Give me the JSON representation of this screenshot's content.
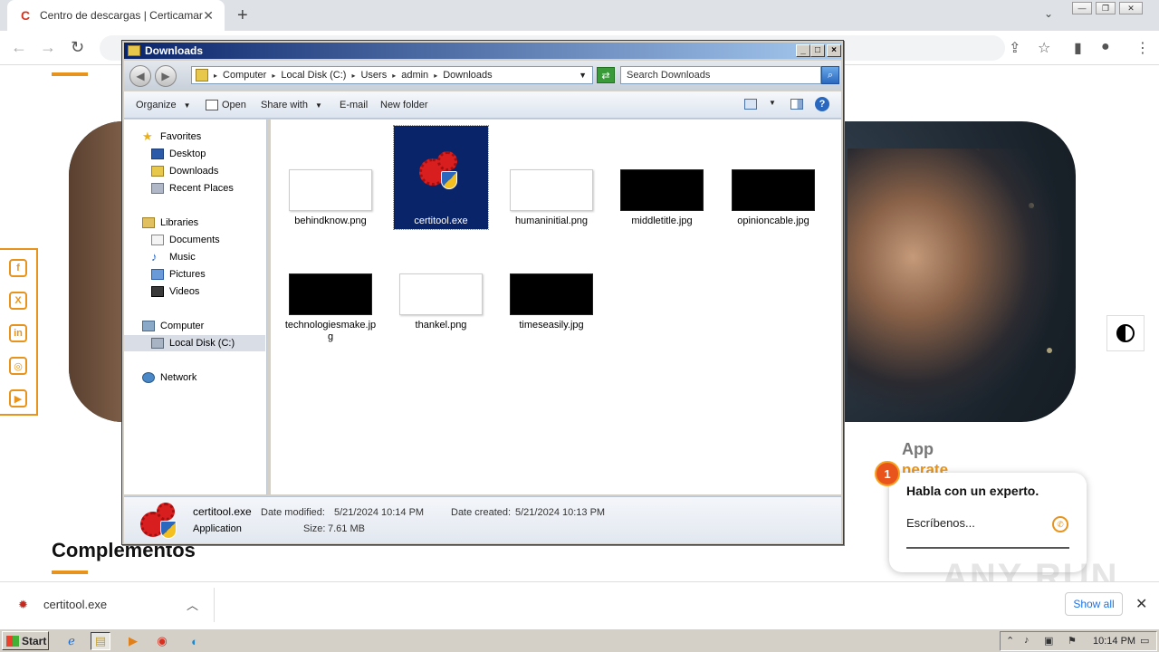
{
  "browser": {
    "tab_title": "Centro de descargas | Certicamara",
    "tab_favicon": "C",
    "new_tab": "+",
    "close_tab": "✕",
    "tab_search": "⌄",
    "win_min": "—",
    "win_restore": "❐",
    "win_close": "✕"
  },
  "page": {
    "app_heading": "App",
    "app_sub": "nerate",
    "complementos": "Complementos",
    "chat_badge": "1",
    "chat_title": "Habla con un experto.",
    "chat_placeholder": "Escríbenos...",
    "watermark": "ANY RUN",
    "social": [
      "f",
      "X",
      "in",
      "◎",
      "▶"
    ]
  },
  "download_shelf": {
    "file_name": "certitool.exe",
    "show_all": "Show all",
    "close": "✕"
  },
  "explorer": {
    "title": "Downloads",
    "breadcrumb": [
      "Computer",
      "Local Disk (C:)",
      "Users",
      "admin",
      "Downloads"
    ],
    "search_placeholder": "Search Downloads",
    "commands": {
      "organize": "Organize",
      "open": "Open",
      "share_with": "Share with",
      "email": "E-mail",
      "new_folder": "New folder"
    },
    "nav": {
      "favorites": "Favorites",
      "desktop": "Desktop",
      "downloads": "Downloads",
      "recent_places": "Recent Places",
      "libraries": "Libraries",
      "documents": "Documents",
      "music": "Music",
      "pictures": "Pictures",
      "videos": "Videos",
      "computer": "Computer",
      "local_disk": "Local Disk (C:)",
      "network": "Network"
    },
    "files": [
      {
        "name": "behindknow.png",
        "thumb": "light"
      },
      {
        "name": "certitool.exe",
        "thumb": "exe",
        "selected": true
      },
      {
        "name": "humaninitial.png",
        "thumb": "light"
      },
      {
        "name": "middletitle.jpg",
        "thumb": "dark"
      },
      {
        "name": "opinioncable.jpg",
        "thumb": "dark"
      },
      {
        "name": "technologiesmake.jpg",
        "thumb": "dark"
      },
      {
        "name": "thankel.png",
        "thumb": "light"
      },
      {
        "name": "timeseasily.jpg",
        "thumb": "dark"
      }
    ],
    "details": {
      "name": "certitool.exe",
      "type": "Application",
      "modified_label": "Date modified:",
      "modified_value": "5/21/2024 10:14 PM",
      "created_label": "Date created:",
      "created_value": "5/21/2024 10:13 PM",
      "size_label": "Size:",
      "size_value": "7.61 MB"
    }
  },
  "taskbar": {
    "start": "Start",
    "clock": "10:14 PM"
  },
  "colors": {
    "accent_orange": "#e8941c",
    "selection_blue": "#0a246a"
  }
}
